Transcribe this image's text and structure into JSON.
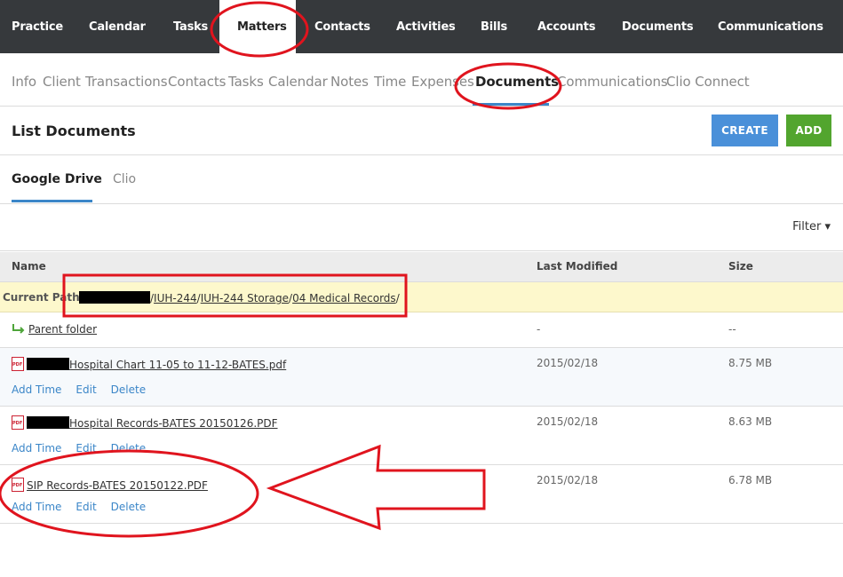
{
  "topnav": {
    "items": [
      {
        "label": "Practice"
      },
      {
        "label": "Calendar"
      },
      {
        "label": "Tasks"
      },
      {
        "label": "Matters"
      },
      {
        "label": "Contacts"
      },
      {
        "label": "Activities"
      },
      {
        "label": "Bills"
      },
      {
        "label": "Accounts"
      },
      {
        "label": "Documents"
      },
      {
        "label": "Communications"
      }
    ],
    "active": "Matters"
  },
  "subnav": {
    "items": [
      {
        "label": "Info"
      },
      {
        "label": "Client"
      },
      {
        "label": "Transactions"
      },
      {
        "label": "Contacts"
      },
      {
        "label": "Tasks"
      },
      {
        "label": "Calendar"
      },
      {
        "label": "Notes"
      },
      {
        "label": "Time"
      },
      {
        "label": "Expenses"
      },
      {
        "label": "Documents"
      },
      {
        "label": "Communications"
      },
      {
        "label": "Clio Connect"
      }
    ],
    "active": "Documents"
  },
  "page": {
    "title": "List Documents",
    "create_label": "CREATE",
    "add_label": "ADD"
  },
  "sources": {
    "tabs": [
      {
        "label": "Google Drive"
      },
      {
        "label": "Clio"
      }
    ],
    "active": "Google Drive"
  },
  "filter": {
    "label": "Filter ▾"
  },
  "table": {
    "headers": {
      "name": "Name",
      "modified": "Last Modified",
      "size": "Size"
    },
    "current_path_label": "Current Path:",
    "path": [
      "IUH-244",
      "IUH-244 Storage",
      "04 Medical Records"
    ],
    "parent": {
      "label": "Parent folder",
      "modified": "-",
      "size": "--"
    },
    "rows": [
      {
        "name": "Hospital Chart 11-05 to 11-12-BATES.pdf",
        "modified": "2015/02/18",
        "size": "8.75 MB",
        "actions": [
          "Add Time",
          "Edit",
          "Delete"
        ]
      },
      {
        "name": "Hospital Records-BATES 20150126.PDF",
        "modified": "2015/02/18",
        "size": "8.63 MB",
        "actions": [
          "Add Time",
          "Edit",
          "Delete"
        ]
      },
      {
        "name": "SIP Records-BATES 20150122.PDF",
        "modified": "2015/02/18",
        "size": "6.78 MB",
        "actions": [
          "Add Time",
          "Edit",
          "Delete"
        ]
      }
    ]
  },
  "colors": {
    "topnav_bg": "#36393c",
    "accent_blue": "#3b86c8",
    "create_btn": "#4a90d9",
    "add_btn": "#52a52e",
    "path_bg": "#fdf8cc",
    "annotation_red": "#e0141e"
  }
}
